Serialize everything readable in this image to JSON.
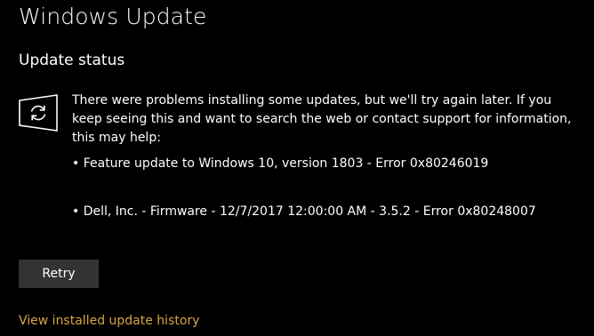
{
  "header": {
    "title": "Windows Update"
  },
  "status": {
    "heading": "Update status",
    "icon": "update-sync-icon",
    "message": "There were problems installing some updates, but we'll try again later. If you keep seeing this and want to search the web or contact support for information, this may help:",
    "errors": [
      "• Feature update to Windows 10, version 1803 - Error 0x80246019",
      "• Dell, Inc. - Firmware - 12/7/2017 12:00:00 AM - 3.5.2 - Error 0x80248007"
    ]
  },
  "actions": {
    "retry_label": "Retry",
    "history_link": "View installed update history"
  },
  "colors": {
    "background": "#000000",
    "text": "#ffffff",
    "button": "#333333",
    "link": "#d9a440"
  }
}
